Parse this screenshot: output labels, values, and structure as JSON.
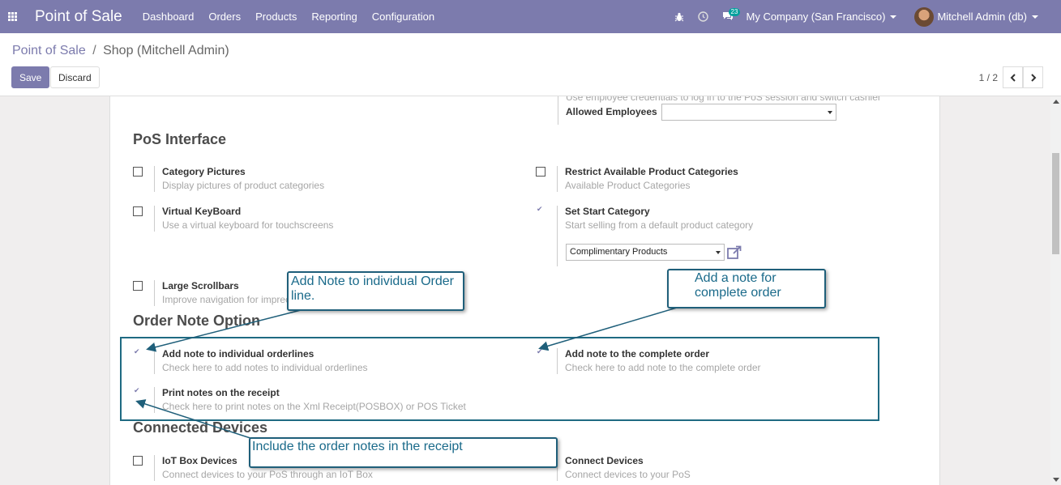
{
  "navbar": {
    "brand": "Point of Sale",
    "menu": [
      "Dashboard",
      "Orders",
      "Products",
      "Reporting",
      "Configuration"
    ],
    "messages_count": "23",
    "company": "My Company (San Francisco)",
    "user": "Mitchell Admin (db)"
  },
  "control_panel": {
    "breadcrumb_root": "Point of Sale",
    "breadcrumb_sep": "/",
    "breadcrumb_current": "Shop (Mitchell Admin)",
    "save_label": "Save",
    "discard_label": "Discard",
    "pager": "1 / 2"
  },
  "top_partial": {
    "desc": "Use employee credentials to log in to the PoS session and switch cashier",
    "allowed_employees_label": "Allowed Employees",
    "allowed_employees_value": ""
  },
  "pos_interface": {
    "title": "PoS Interface",
    "settings": [
      {
        "title": "Category Pictures",
        "desc": "Display pictures of product categories",
        "checked": false
      },
      {
        "title": "Restrict Available Product Categories",
        "desc": "Available Product Categories",
        "checked": false
      },
      {
        "title": "Virtual KeyBoard",
        "desc": "Use a virtual keyboard for touchscreens",
        "checked": false
      },
      {
        "title": "Set Start Category",
        "desc": "Start selling from a default product category",
        "checked": true
      },
      {
        "title": "Large Scrollbars",
        "desc": "Improve navigation for imprecise industrial touchscreens",
        "checked": false
      }
    ],
    "start_category_value": "Complimentary Products"
  },
  "order_note": {
    "title": "Order Note Option",
    "settings": [
      {
        "title": "Add note to individual orderlines",
        "desc": "Check here to add notes to individual orderlines",
        "checked": true
      },
      {
        "title": "Add note to the complete order",
        "desc": "Check here to add note to the complete order",
        "checked": true
      },
      {
        "title": "Print notes on the receipt",
        "desc": "Check here to print notes on the Xml Receipt(POSBOX) or POS Ticket",
        "checked": true
      }
    ]
  },
  "connected_devices": {
    "title": "Connected Devices",
    "settings": [
      {
        "title": "IoT Box Devices",
        "desc": "Connect devices to your PoS through an IoT Box",
        "checked": false
      },
      {
        "title": "Connect Devices",
        "desc": "Connect devices to your PoS"
      }
    ]
  },
  "callouts": {
    "orderline": "Add Note to individual Order line.",
    "complete": "Add a note for complete order",
    "receipt": "Include the order notes in the receipt"
  },
  "colors": {
    "brand": "#7c7bad",
    "annotation": "#1f5f7a"
  }
}
